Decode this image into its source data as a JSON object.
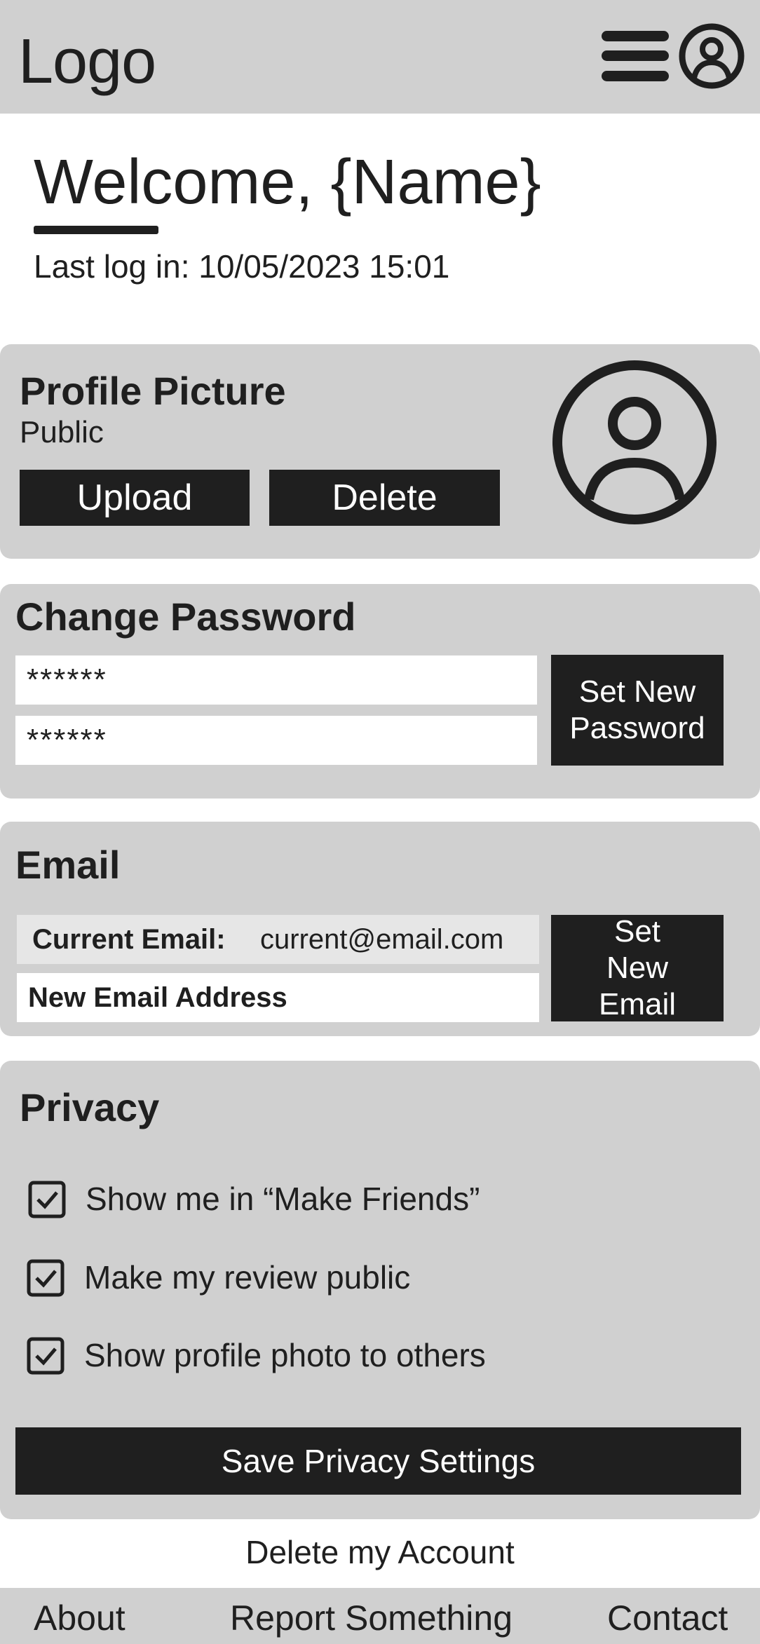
{
  "header": {
    "logo": "Logo"
  },
  "welcome": {
    "greeting": "Welcome, {Name}",
    "last_login": "Last log in: 10/05/2023 15:01"
  },
  "profile_picture": {
    "title": "Profile Picture",
    "visibility": "Public",
    "upload_label": "Upload",
    "delete_label": "Delete"
  },
  "change_password": {
    "title": "Change Password",
    "password_value": "******",
    "confirm_value": "******",
    "button_label": "Set New Password"
  },
  "email": {
    "title": "Email",
    "current_label": "Current Email:",
    "current_value": "current@email.com",
    "new_placeholder": "New Email Address",
    "button_label": "Set New Email"
  },
  "privacy": {
    "title": "Privacy",
    "options": [
      {
        "label": "Show me in “Make Friends”",
        "checked": true
      },
      {
        "label": "Make my review public",
        "checked": true
      },
      {
        "label": "Show profile photo to others",
        "checked": true
      }
    ],
    "save_label": "Save Privacy Settings"
  },
  "delete_account_label": "Delete my Account",
  "footer": {
    "about": "About",
    "report": "Report Something",
    "contact": "Contact"
  },
  "colors": {
    "panel": "#d0d0d0",
    "dark": "#1f1f1f",
    "field": "#ffffff",
    "field_readonly": "#e6e6e6"
  }
}
